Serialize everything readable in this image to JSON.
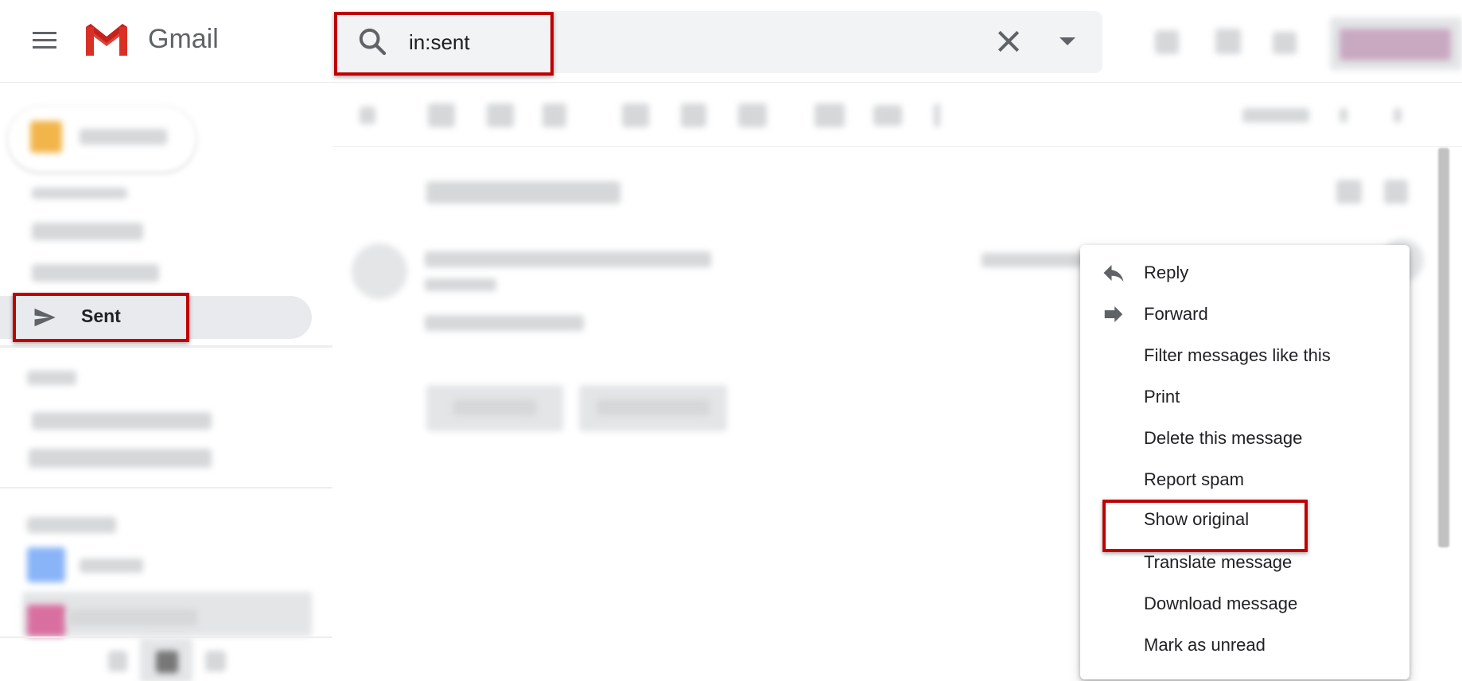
{
  "app": {
    "name": "Gmail"
  },
  "search": {
    "value": "in:sent"
  },
  "sidebar": {
    "sent_label": "Sent"
  },
  "context_menu": {
    "items": [
      {
        "label": "Reply",
        "icon": "reply-icon"
      },
      {
        "label": "Forward",
        "icon": "forward-icon"
      },
      {
        "label": "Filter messages like this"
      },
      {
        "label": "Print"
      },
      {
        "label": "Delete this message"
      },
      {
        "label": "Report spam"
      },
      {
        "label": "Show original"
      },
      {
        "label": "Translate message"
      },
      {
        "label": "Download message"
      },
      {
        "label": "Mark as unread"
      }
    ]
  },
  "colors": {
    "highlight": "#c00000",
    "gmail_red": "#db4437",
    "selected_bg": "#e8eaed"
  }
}
